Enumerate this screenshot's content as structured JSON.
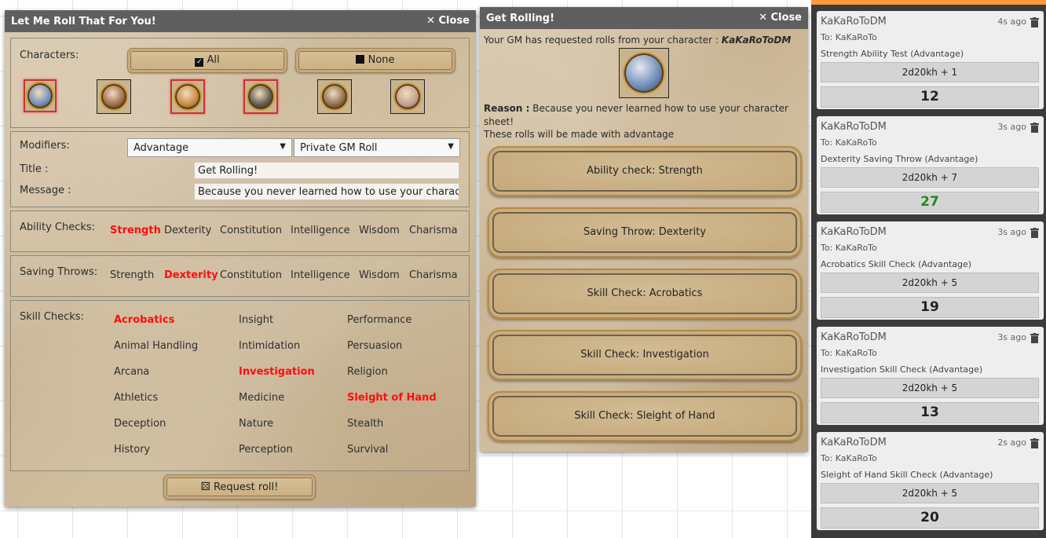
{
  "left_dialog": {
    "title": "Let Me Roll That For You!",
    "close_label": "Close",
    "characters_label": "Characters:",
    "all_label": "All",
    "none_label": "None",
    "avatars": [
      {
        "name": "avatar-character-1",
        "selected": true,
        "color": "#6f8fb8"
      },
      {
        "name": "avatar-character-2",
        "selected": false,
        "color": "#9b6a45"
      },
      {
        "name": "avatar-character-3",
        "selected": true,
        "color": "#c58a3e"
      },
      {
        "name": "avatar-character-4",
        "selected": true,
        "color": "#5b5b4d"
      },
      {
        "name": "avatar-character-5",
        "selected": false,
        "color": "#8d6a4c"
      },
      {
        "name": "avatar-character-6",
        "selected": false,
        "color": "#c29e8f"
      }
    ],
    "modifiers_label": "Modifiers:",
    "modifier_select": "Advantage",
    "visibility_select": "Private GM Roll",
    "title_label": "Title :",
    "title_value": "Get Rolling!",
    "message_label": "Message :",
    "message_value": "Because you never learned how to use your character sh",
    "ability_label": "Ability Checks:",
    "abilities": [
      {
        "label": "Strength",
        "on": true
      },
      {
        "label": "Dexterity",
        "on": false
      },
      {
        "label": "Constitution",
        "on": false
      },
      {
        "label": "Intelligence",
        "on": false
      },
      {
        "label": "Wisdom",
        "on": false
      },
      {
        "label": "Charisma",
        "on": false
      }
    ],
    "saves_label": "Saving Throws:",
    "saves": [
      {
        "label": "Strength",
        "on": false
      },
      {
        "label": "Dexterity",
        "on": true
      },
      {
        "label": "Constitution",
        "on": false
      },
      {
        "label": "Intelligence",
        "on": false
      },
      {
        "label": "Wisdom",
        "on": false
      },
      {
        "label": "Charisma",
        "on": false
      }
    ],
    "skills_label": "Skill Checks:",
    "skills": [
      {
        "label": "Acrobatics",
        "on": true
      },
      {
        "label": "Animal Handling",
        "on": false
      },
      {
        "label": "Arcana",
        "on": false
      },
      {
        "label": "Athletics",
        "on": false
      },
      {
        "label": "Deception",
        "on": false
      },
      {
        "label": "History",
        "on": false
      },
      {
        "label": "Insight",
        "on": false
      },
      {
        "label": "Intimidation",
        "on": false
      },
      {
        "label": "Investigation",
        "on": true
      },
      {
        "label": "Medicine",
        "on": false
      },
      {
        "label": "Nature",
        "on": false
      },
      {
        "label": "Perception",
        "on": false
      },
      {
        "label": "Performance",
        "on": false
      },
      {
        "label": "Persuasion",
        "on": false
      },
      {
        "label": "Religion",
        "on": false
      },
      {
        "label": "Sleight of Hand",
        "on": true
      },
      {
        "label": "Stealth",
        "on": false
      },
      {
        "label": "Survival",
        "on": false
      }
    ],
    "request_label": "Request roll!"
  },
  "mid_dialog": {
    "title": "Get Rolling!",
    "close_label": "Close",
    "intro": "Your GM has requested rolls from your character :",
    "character": "KaKaRoToDM",
    "reason_label": "Reason :",
    "reason_text": "Because you never learned how to use your character sheet!",
    "advantage_note": "These rolls will be made with advantage",
    "buttons": [
      "Ability check: Strength",
      "Saving Throw: Dexterity",
      "Skill Check: Acrobatics",
      "Skill Check: Investigation",
      "Skill Check: Sleight of Hand"
    ]
  },
  "chat": {
    "messages": [
      {
        "who": "KaKaRoToDM",
        "time": "4s ago",
        "to": "To: KaKaRoTo",
        "desc": "Strength Ability Test (Advantage)",
        "formula": "2d20kh + 1",
        "result": "12",
        "crit": false
      },
      {
        "who": "KaKaRoToDM",
        "time": "3s ago",
        "to": "To: KaKaRoTo",
        "desc": "Dexterity Saving Throw (Advantage)",
        "formula": "2d20kh + 7",
        "result": "27",
        "crit": true
      },
      {
        "who": "KaKaRoToDM",
        "time": "3s ago",
        "to": "To: KaKaRoTo",
        "desc": "Acrobatics Skill Check (Advantage)",
        "formula": "2d20kh + 5",
        "result": "19",
        "crit": false
      },
      {
        "who": "KaKaRoToDM",
        "time": "3s ago",
        "to": "To: KaKaRoTo",
        "desc": "Investigation Skill Check (Advantage)",
        "formula": "2d20kh + 5",
        "result": "13",
        "crit": false
      },
      {
        "who": "KaKaRoToDM",
        "time": "2s ago",
        "to": "To: KaKaRoTo",
        "desc": "Sleight of Hand Skill Check (Advantage)",
        "formula": "2d20kh + 5",
        "result": "20",
        "crit": false
      }
    ]
  },
  "colors": {
    "selected_option": "#ff0d0d",
    "crit_result": "#1d8a1d",
    "titlebar": "#5f5f5f"
  }
}
